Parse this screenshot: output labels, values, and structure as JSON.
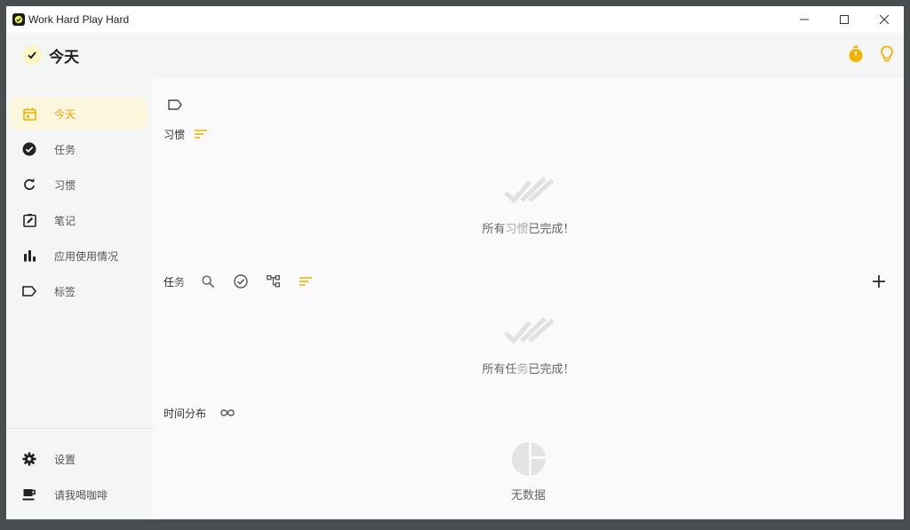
{
  "window": {
    "title": "Work Hard Play Hard",
    "controls": [
      "minimize",
      "maximize",
      "close"
    ]
  },
  "header": {
    "title": "今天",
    "actions": [
      {
        "icon": "timer-icon",
        "color": "#f0b400"
      },
      {
        "icon": "lightbulb-icon",
        "color": "#f0b400"
      }
    ]
  },
  "sidebar": {
    "items": [
      {
        "label": "今天",
        "icon": "calendar-icon",
        "active": true
      },
      {
        "label": "任务",
        "icon": "check-circle-icon"
      },
      {
        "label": "习惯",
        "icon": "refresh-icon"
      },
      {
        "label": "笔记",
        "icon": "note-icon"
      },
      {
        "label": "应用使用情况",
        "icon": "bar-chart-icon"
      },
      {
        "label": "标签",
        "icon": "tag-icon"
      }
    ],
    "footer": [
      {
        "label": "设置",
        "icon": "gear-icon"
      },
      {
        "label": "请我喝咖啡",
        "icon": "coffee-icon"
      }
    ]
  },
  "main": {
    "habits": {
      "title": "习惯",
      "empty_prefix": "所有",
      "empty_highlight": "习惯",
      "empty_suffix": "已完成！"
    },
    "tasks": {
      "title_a": "任",
      "title_b": "务",
      "empty_prefix": "所有任",
      "empty_highlight": "务",
      "empty_suffix": "已完成！"
    },
    "time_distribution": {
      "title": "时间分布",
      "empty": "无数据"
    }
  },
  "colors": {
    "accent": "#f0b400",
    "active_bg": "#fcf6dc",
    "sidebar_bg": "#f4f5f5"
  }
}
